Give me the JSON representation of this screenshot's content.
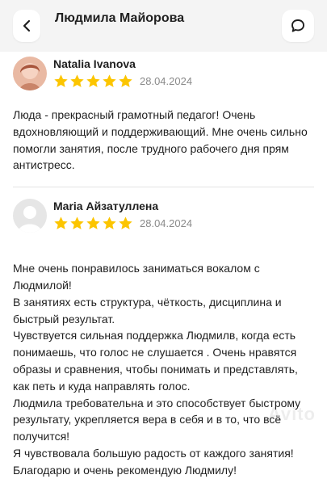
{
  "header": {
    "title": "Людмила Майорова",
    "back_icon": "chevron-left-icon",
    "chat_icon": "chat-bubble-icon"
  },
  "reviews": [
    {
      "author": "Natalia Ivanova",
      "rating": 5,
      "date": "28.04.2024",
      "text": "Люда - прекрасный грамотный педагог! Очень вдохновляющий и поддерживающий. Мне очень сильно помогли занятия, после трудного рабочего дня прям антистресс."
    },
    {
      "author": "Maria Айзатуллена",
      "rating": 5,
      "date": "28.04.2024",
      "lines": [
        "Мне очень понравилось заниматься вокалом с Людмилой!",
        "В занятиях есть структура, чёткость, дисциплина и быстрый результат.",
        "Чувствуется сильная поддержка Людмилв, когда есть понимаешь, что голос не слушается . Очень нравятся образы и сравнения, чтобы понимать и представлять, как петь и куда направлять голос.",
        "Людмила требовательна и это способствует быстрому результату, укрепляется вера в себя и в то, что всё получится!",
        "Я чувствовала большую радость от каждого занятия! Благодарю и очень рекомендую Людмилу!"
      ]
    }
  ],
  "colors": {
    "star": "#fcc500",
    "header_bg": "#f4f4f4",
    "date": "#8a8a8a"
  },
  "watermark": "Avito"
}
